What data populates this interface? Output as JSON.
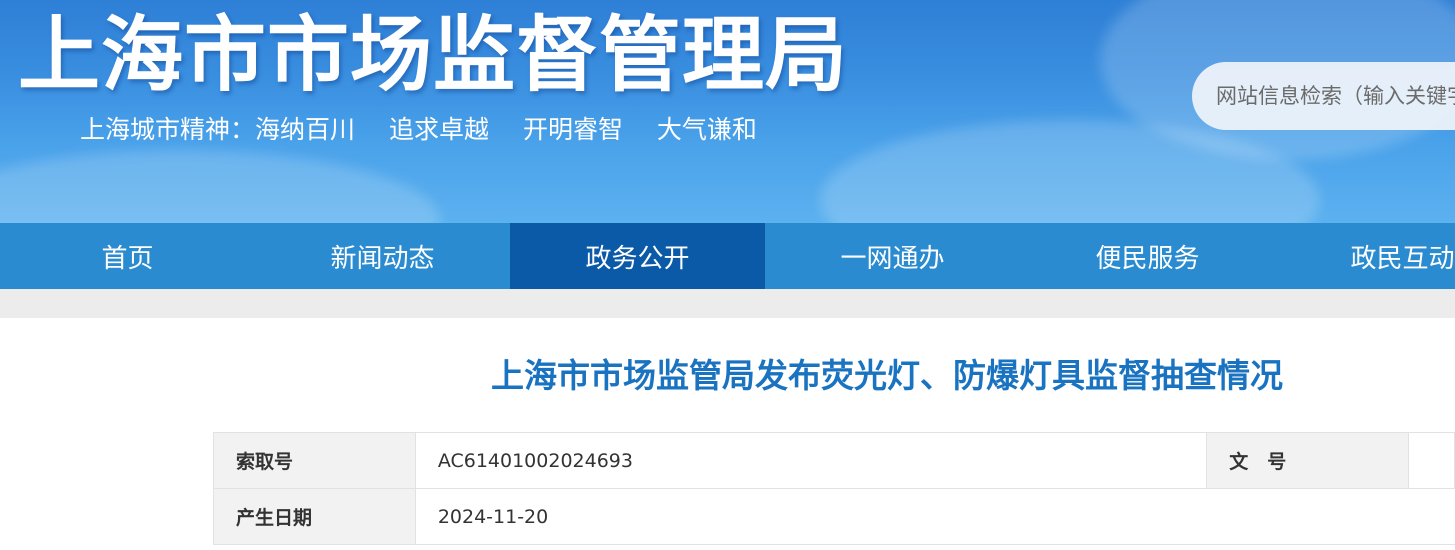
{
  "header": {
    "title": "上海市市场监督管理局",
    "slogan": {
      "prefix": "上海城市精神：",
      "parts": [
        "海纳百川",
        "追求卓越",
        "开明睿智",
        "大气谦和"
      ]
    },
    "search_placeholder": "网站信息检索（输入关键字）"
  },
  "nav": {
    "items": [
      {
        "label": "首页"
      },
      {
        "label": "新闻动态"
      },
      {
        "label": "政务公开",
        "active": true
      },
      {
        "label": "一网通办"
      },
      {
        "label": "便民服务"
      },
      {
        "label": "政民互动"
      }
    ]
  },
  "article": {
    "title": "上海市市场监管局发布荧光灯、防爆灯具监督抽查情况"
  },
  "meta": {
    "index_label": "索取号",
    "index_value": "AC61401002024693",
    "doc_no_label": "文　号",
    "doc_no_value": "",
    "date_label": "产生日期",
    "date_value": "2024-11-20"
  },
  "colors": {
    "nav_bg": "#2a8bd0",
    "nav_active": "#0a5aa8",
    "title_blue": "#1a73c0"
  }
}
